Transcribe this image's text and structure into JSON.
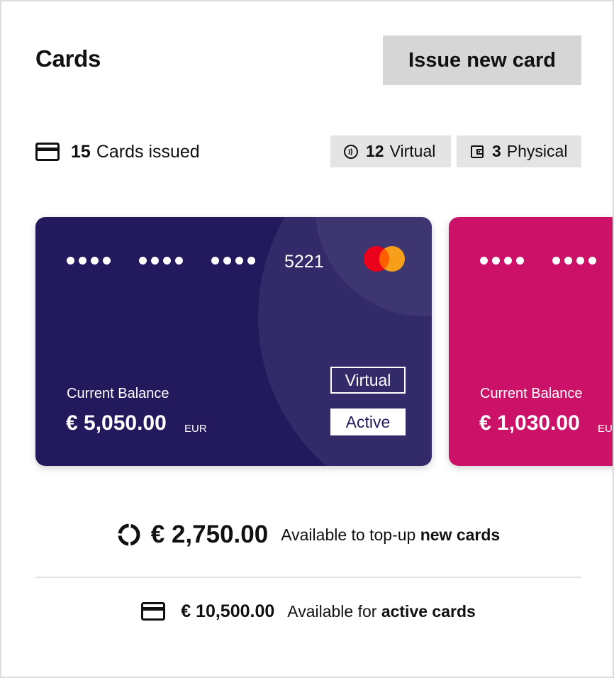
{
  "header": {
    "title": "Cards",
    "issue_button_label": "Issue new card"
  },
  "stats": {
    "issued_count": "15",
    "issued_label": "Cards issued",
    "virtual_count": "12",
    "virtual_label": "Virtual",
    "physical_count": "3",
    "physical_label": "Physical",
    "icons": [
      "credit-card-icon",
      "contactless-icon",
      "wallet-icon"
    ]
  },
  "cards": [
    {
      "masked_groups": 3,
      "last_four": "5221",
      "brand": "mastercard",
      "type_badge": "Virtual",
      "status_badge": "Active",
      "balance_label": "Current Balance",
      "balance": "€ 5,050.00",
      "currency": "EUR",
      "color": "#231a5e"
    },
    {
      "masked_groups": 2,
      "balance_label": "Current Balance",
      "balance": "€ 1,030.00",
      "currency": "EUR",
      "color": "#cc1268"
    }
  ],
  "summary": {
    "topup_amount": "€ 2,750.00",
    "topup_text": "Available to top-up ",
    "topup_bold": "new cards",
    "active_amount": "€ 10,500.00",
    "active_text": "Available for ",
    "active_bold": "active cards"
  },
  "colors": {
    "accent_dark": "#231a5e",
    "accent_pink": "#cc1268",
    "button_bg": "#d6d6d6",
    "mc_red": "#eb001b",
    "mc_orange": "#f79e1b"
  }
}
